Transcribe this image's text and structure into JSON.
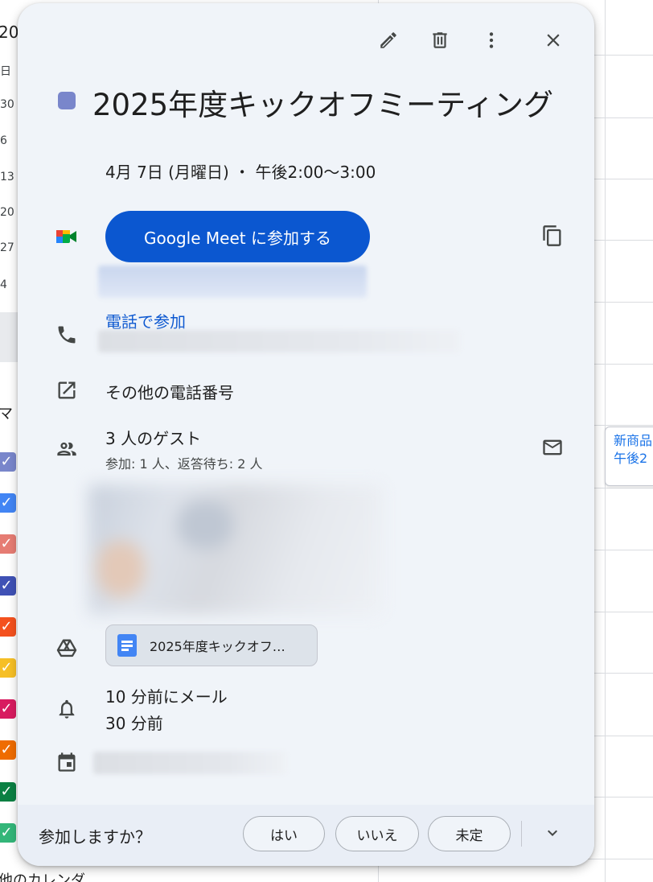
{
  "background": {
    "mini_calendar": {
      "year_fragment": "20",
      "weekday_fragment": "日",
      "day_numbers": [
        "30",
        "6",
        "13",
        "20",
        "27",
        "4"
      ],
      "my_calendars_fragment": "マ",
      "checkbox_colors": [
        "#7986cb",
        "#4285f4",
        "#e67c73",
        "#3f51b5",
        "#f4511e",
        "#f6bf26",
        "#d81b60",
        "#ef6c00",
        "#0b8043",
        "#33b679"
      ],
      "other_calendars_fragment": "他のカレンダ"
    },
    "grid_event": {
      "line1": "新商品",
      "line2": "午後2"
    }
  },
  "toolbar": {
    "edit_icon": "pencil-icon",
    "delete_icon": "trash-icon",
    "more_icon": "more-vert-icon",
    "close_icon": "close-icon"
  },
  "event": {
    "color": "#7986cb",
    "title": "2025年度キックオフミーティング",
    "datetime": "4月 7日 (月曜日)  ・  午後2:00～3:00"
  },
  "meet": {
    "join_label": "Google Meet に参加する",
    "copy_icon": "copy-icon"
  },
  "phone": {
    "link_label": "電話で参加"
  },
  "other_numbers": {
    "label": "その他の電話番号"
  },
  "guests": {
    "title": "3 人のゲスト",
    "summary": "参加: 1 人、返答待ち: 2 人"
  },
  "attachment": {
    "label": "2025年度キックオフ…"
  },
  "reminders": [
    "10 分前にメール",
    "30 分前"
  ],
  "colors": {
    "accent": "#0b57d0",
    "dialog_bg": "#f0f4f9"
  },
  "footer": {
    "question": "参加しますか？",
    "yes": "はい",
    "no": "いいえ",
    "maybe": "未定"
  }
}
